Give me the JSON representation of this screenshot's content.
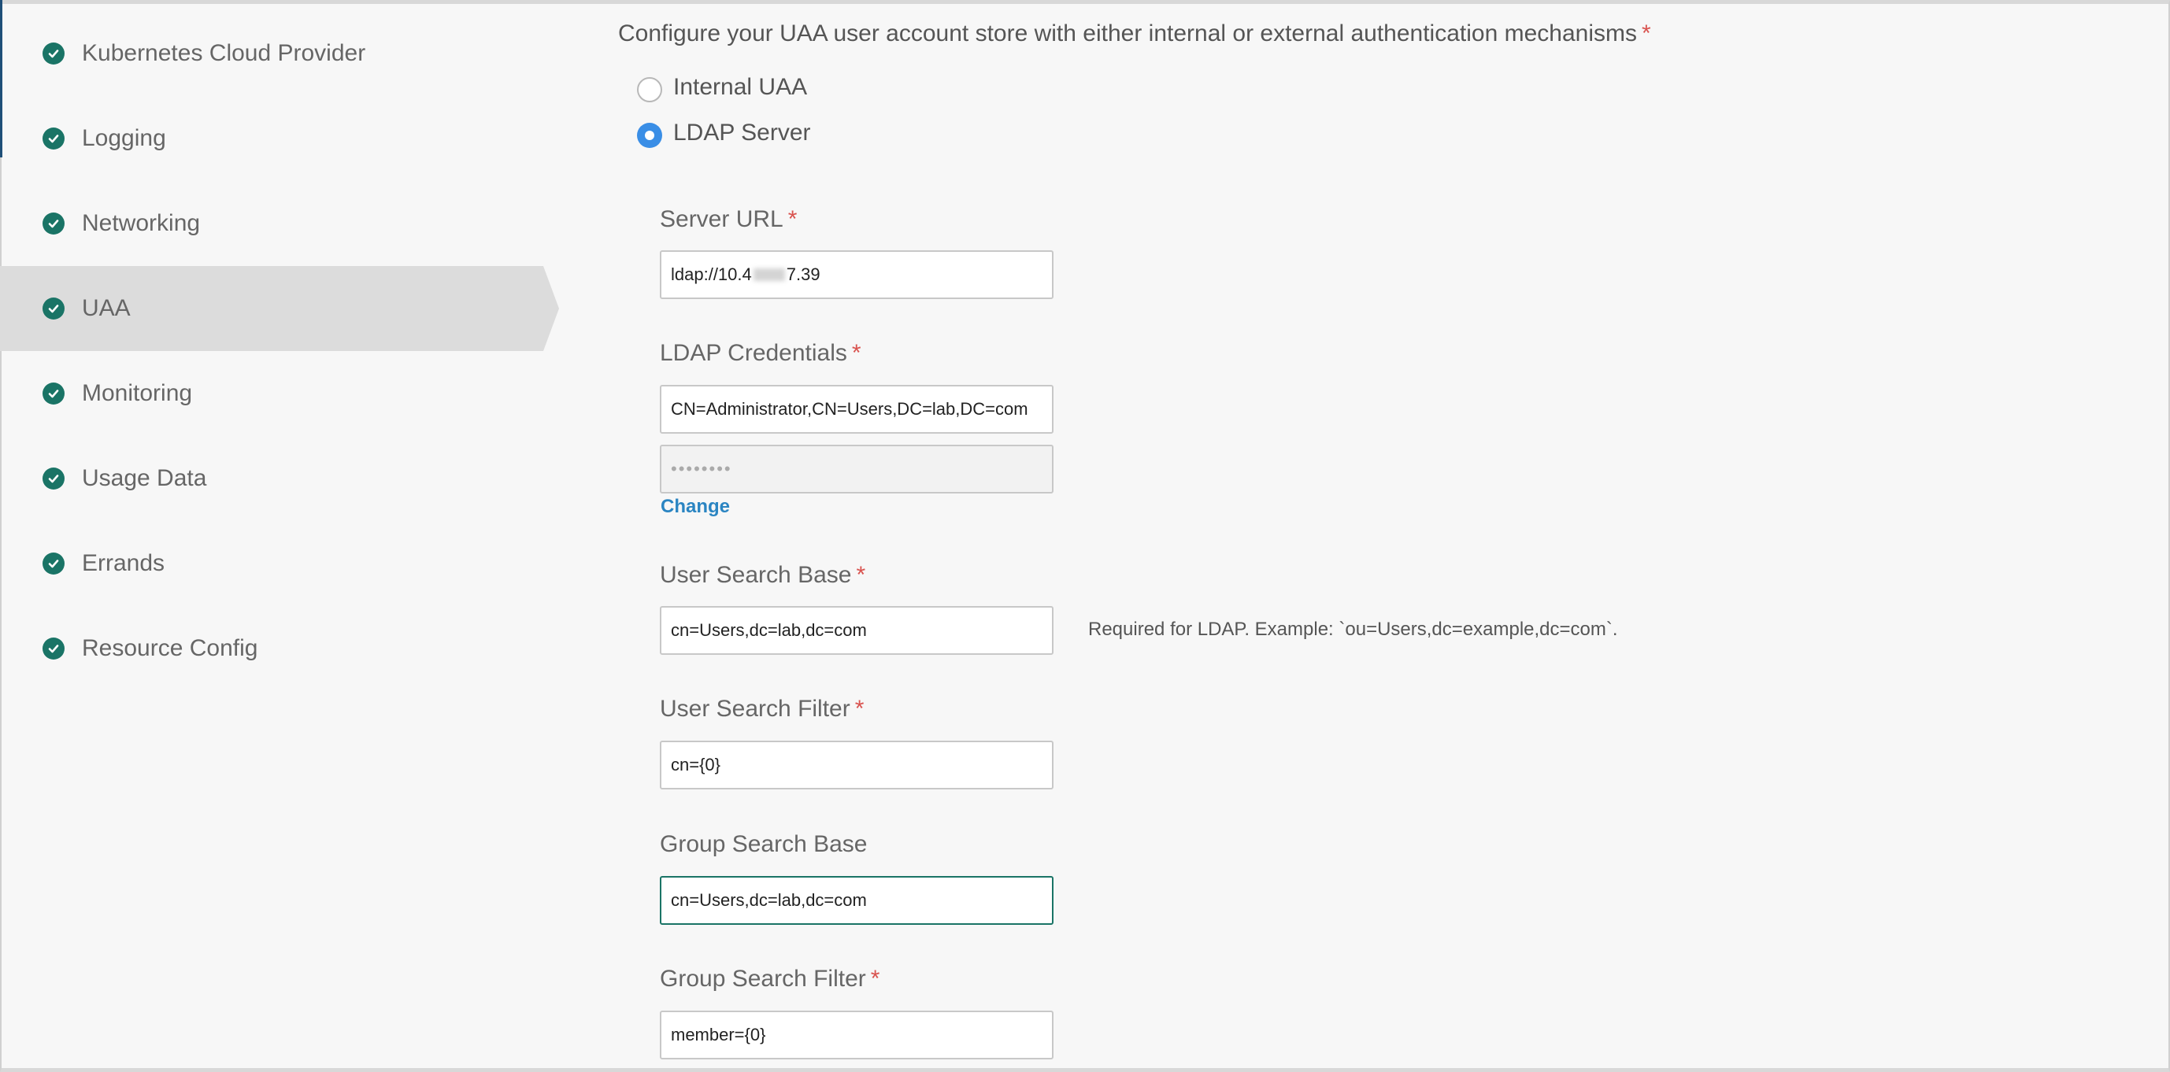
{
  "sidebar": {
    "items": [
      {
        "label": "Kubernetes Cloud Provider"
      },
      {
        "label": "Logging"
      },
      {
        "label": "Networking"
      },
      {
        "label": "UAA"
      },
      {
        "label": "Monitoring"
      },
      {
        "label": "Usage Data"
      },
      {
        "label": "Errands"
      },
      {
        "label": "Resource Config"
      }
    ],
    "active_item": "UAA"
  },
  "main": {
    "intro": "Configure your UAA user account store with either internal or external authentication mechanisms",
    "required_mark": "*",
    "auth_options": [
      {
        "label": "Internal UAA",
        "selected": false
      },
      {
        "label": "LDAP Server",
        "selected": true
      }
    ],
    "server_url": {
      "label": "Server URL",
      "value_prefix": "ldap://10.4",
      "value_suffix": "7.39"
    },
    "ldap_credentials": {
      "label": "LDAP Credentials",
      "username": "CN=Administrator,CN=Users,DC=lab,DC=com",
      "password_mask": "••••••••",
      "change_link": "Change"
    },
    "user_search_base": {
      "label": "User Search Base",
      "value": "cn=Users,dc=lab,dc=com",
      "help": "Required for LDAP. Example: `ou=Users,dc=example,dc=com`."
    },
    "user_search_filter": {
      "label": "User Search Filter",
      "value": "cn={0}"
    },
    "group_search_base": {
      "label": "Group Search Base",
      "value": "cn=Users,dc=lab,dc=com"
    },
    "group_search_filter": {
      "label": "Group Search Filter",
      "value": "member={0}"
    }
  },
  "colors": {
    "accent_teal": "#1a7466",
    "radio_blue": "#3a8ee6",
    "required_red": "#d9534f",
    "link_blue": "#2b85c2"
  }
}
